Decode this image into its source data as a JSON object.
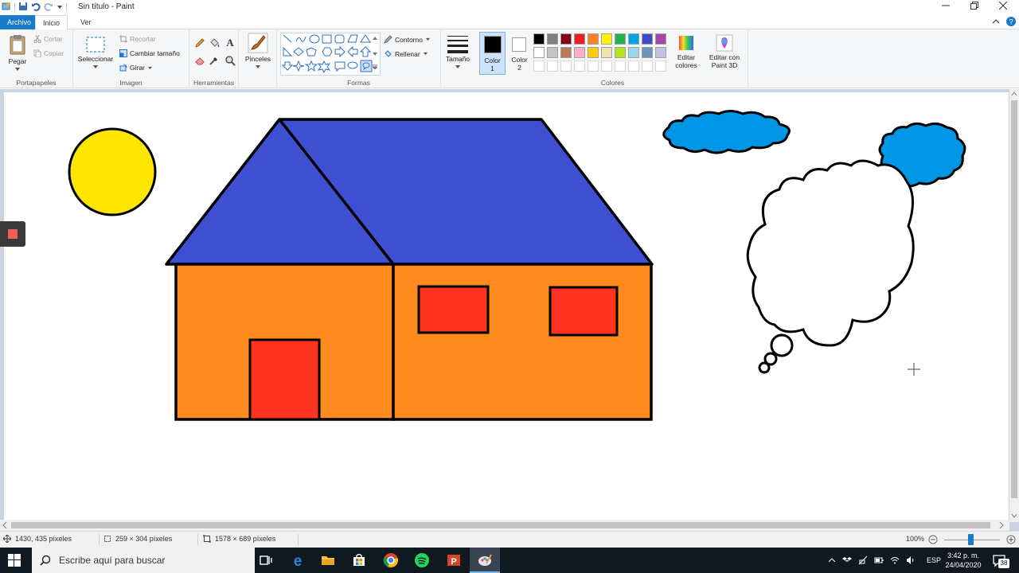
{
  "window": {
    "title": "Sin título - Paint"
  },
  "tabs": {
    "file": "Archivo",
    "home": "Inicio",
    "view": "Ver"
  },
  "ribbon": {
    "clipboard": {
      "label": "Portapapeles",
      "paste": "Pegar",
      "cut": "Cortar",
      "copy": "Copiar"
    },
    "image": {
      "label": "Imagen",
      "select": "Seleccionar",
      "crop": "Recortar",
      "resize": "Cambiar tamaño",
      "rotate": "Girar"
    },
    "tools": {
      "label": "Herramientas"
    },
    "brushes": {
      "label": "Pinceles"
    },
    "shapes": {
      "label": "Formas",
      "outline": "Contorno",
      "fill": "Rellenar"
    },
    "size": {
      "label": "Tamaño"
    },
    "colors": {
      "label": "Colores",
      "color1_line1": "Color",
      "color1_line2": "1",
      "color2_line1": "Color",
      "color2_line2": "2",
      "edit_line1": "Editar",
      "edit_line2": "colores",
      "paint3d_line1": "Editar con",
      "paint3d_line2": "Paint 3D",
      "color1_value": "#000000",
      "color2_value": "#ffffff",
      "palette_row1": [
        "#000000",
        "#7f7f7f",
        "#880015",
        "#ed1c24",
        "#ff7f27",
        "#fff200",
        "#22b14c",
        "#00a2e8",
        "#3f48cc",
        "#a349a4"
      ],
      "palette_row2": [
        "#ffffff",
        "#c3c3c3",
        "#b97a57",
        "#ffaec9",
        "#ffc90e",
        "#efe4b0",
        "#b5e61d",
        "#99d9ea",
        "#7092be",
        "#c8bfe7"
      ]
    }
  },
  "drawing": {
    "sun_color": "#ffe600",
    "roof_color": "#3f4fd1",
    "wall_color": "#ff8a1e",
    "window_door_color": "#ff3322",
    "cloud_color": "#0096e6"
  },
  "statusbar": {
    "cursor_pos": "1430, 435 píxeles",
    "selection_size": "259 × 304 píxeles",
    "image_size": "1578 × 689 píxeles",
    "zoom": "100%"
  },
  "taskbar": {
    "search_placeholder": "Escribe aquí para buscar",
    "time": "3:42 p. m.",
    "date": "24/04/2020",
    "lang": "ESP",
    "notifications": "38"
  }
}
